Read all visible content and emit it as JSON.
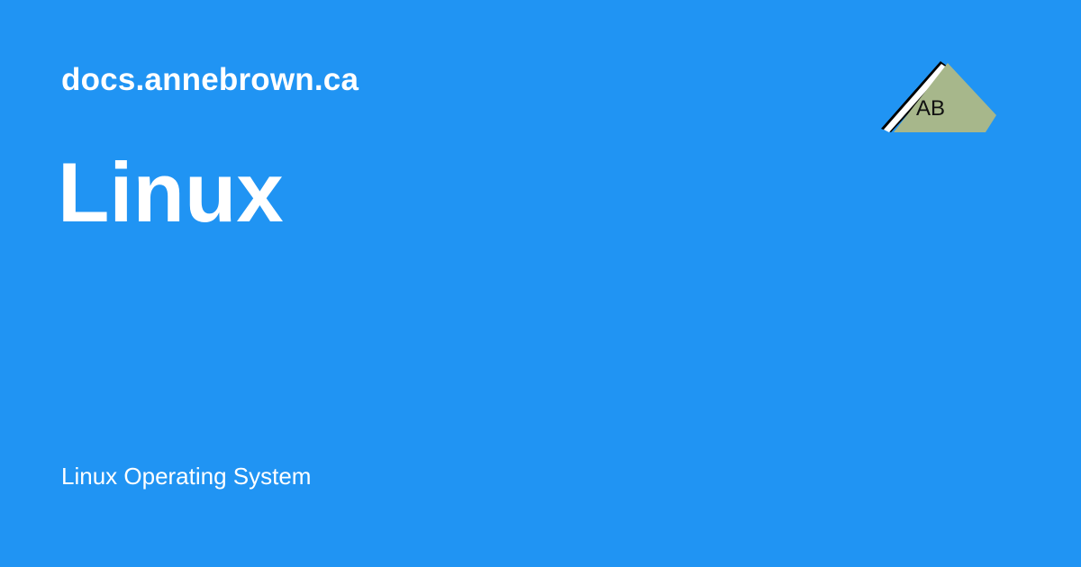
{
  "header": {
    "site": "docs.annebrown.ca"
  },
  "main": {
    "title": "Linux",
    "description": "Linux Operating System"
  },
  "logo": {
    "text": "AB",
    "icon": "ab-triangle-logo-icon"
  },
  "colors": {
    "background": "#2094f3",
    "text": "#ffffff",
    "logo_fill": "#a7b78b",
    "logo_stroke": "#000000",
    "logo_highlight": "#ffffff"
  }
}
